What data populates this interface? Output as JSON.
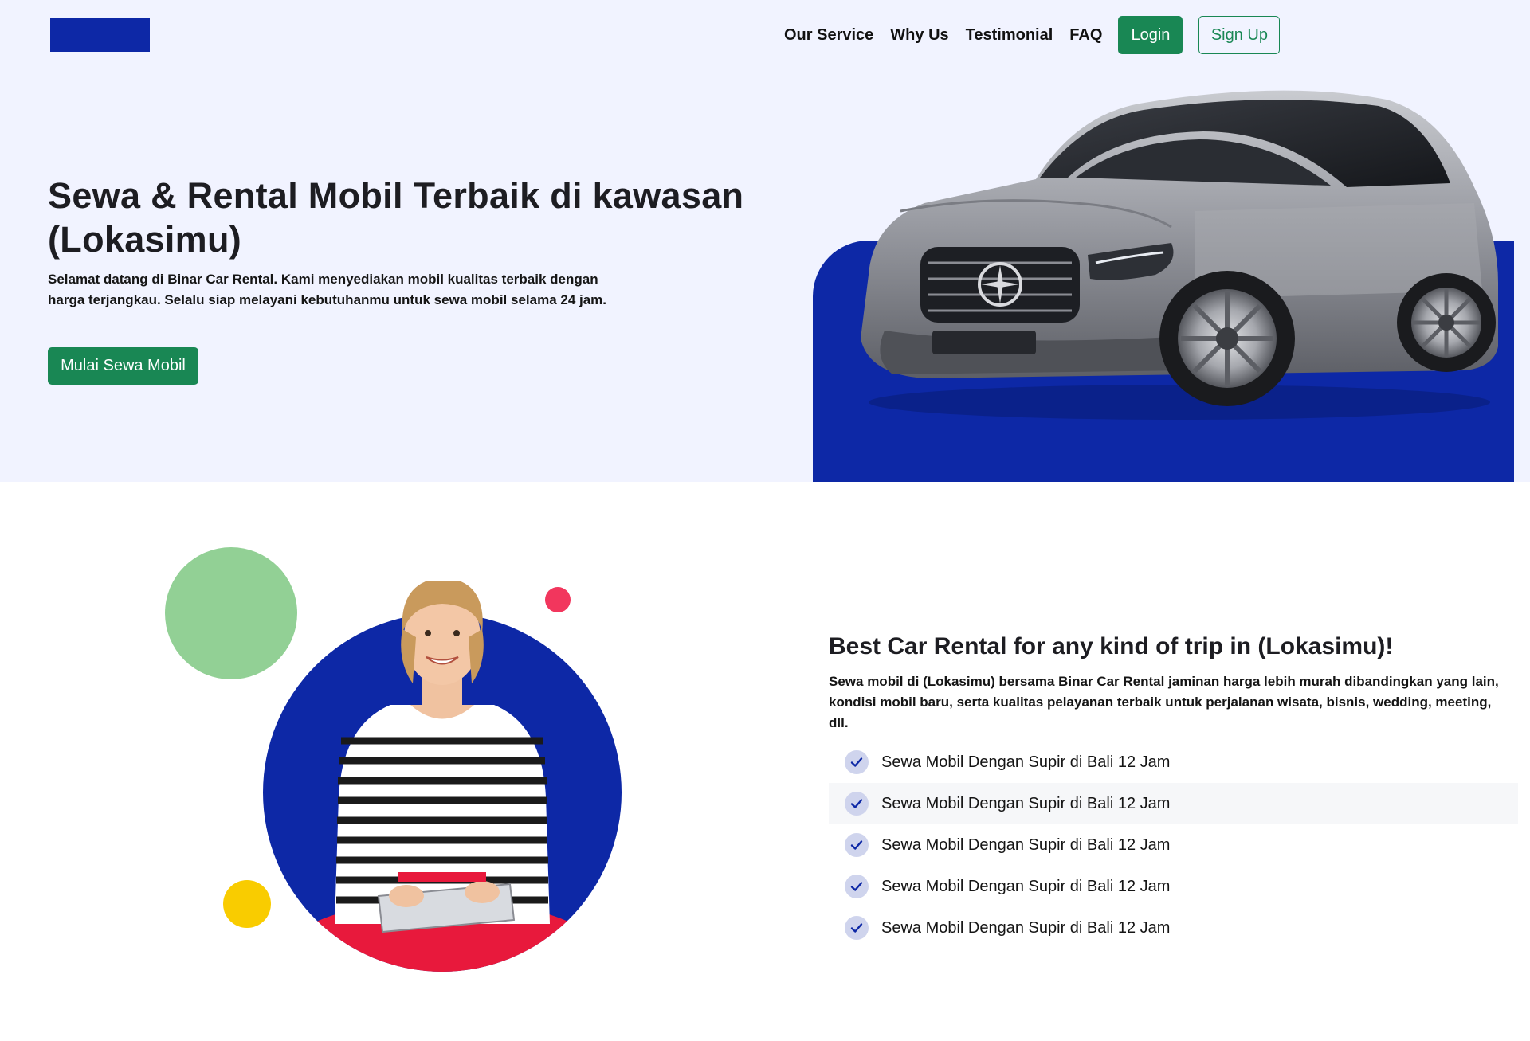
{
  "nav": {
    "links": [
      "Our Service",
      "Why Us",
      "Testimonial",
      "FAQ"
    ],
    "login_label": "Login",
    "signup_label": "Sign Up"
  },
  "hero": {
    "title": "Sewa & Rental Mobil Terbaik di kawasan (Lokasimu)",
    "description": "Selamat datang di Binar Car Rental. Kami menyediakan mobil kualitas terbaik dengan harga terjangkau. Selalu siap melayani kebutuhanmu untuk sewa mobil selama 24 jam.",
    "cta_label": "Mulai Sewa Mobil"
  },
  "why": {
    "title": "Best Car Rental for any kind of trip in (Lokasimu)!",
    "description": "Sewa mobil di (Lokasimu) bersama Binar Car Rental jaminan harga lebih murah dibandingkan yang lain, kondisi mobil baru, serta kualitas pelayanan terbaik untuk perjalanan wisata, bisnis, wedding, meeting, dll.",
    "features": [
      "Sewa Mobil Dengan Supir di Bali 12 Jam",
      "Sewa Mobil Dengan Supir di Bali 12 Jam",
      "Sewa Mobil Dengan Supir di Bali 12 Jam",
      "Sewa Mobil Dengan Supir di Bali 12 Jam",
      "Sewa Mobil Dengan Supir di Bali 12 Jam"
    ]
  },
  "colors": {
    "brand_blue": "#0d28a6",
    "primary_green": "#198754",
    "hero_bg": "#f1f3ff",
    "check_bg": "#cfd4ed",
    "accent_green_circle": "#92d095",
    "accent_red_dot": "#f2365d",
    "accent_yellow_dot": "#f9cc00"
  },
  "icons": {
    "feature_check": "check-circle-icon"
  }
}
